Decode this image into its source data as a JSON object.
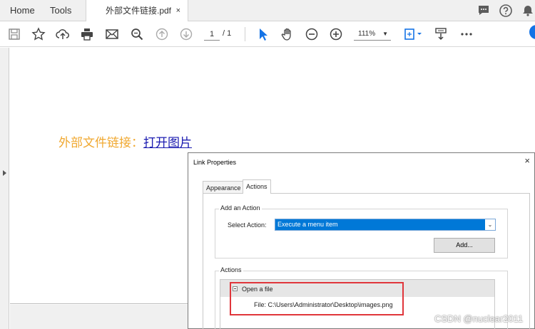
{
  "tabs": {
    "home": "Home",
    "tools": "Tools",
    "document": "外部文件链接.pdf",
    "close": "×"
  },
  "toolbar": {
    "icons": [
      "save-icon",
      "star-icon",
      "cloud-upload-icon",
      "print-icon",
      "email-icon",
      "zoom-search-icon",
      "page-up-icon",
      "page-down-icon",
      "select-arrow-icon",
      "hand-icon",
      "zoom-out-icon",
      "zoom-in-icon",
      "fit-page-icon",
      "scroll-mode-icon",
      "more-icon"
    ],
    "page_current": "1",
    "page_total": "/ 1",
    "zoom": "111%",
    "zoom_caret": "▼"
  },
  "document": {
    "text_prefix": "外部文件链接：",
    "link_text": "打开图片",
    "text_color": "#f0a830",
    "link_color": "#1a1ab0"
  },
  "dialog": {
    "title": "Link Properties",
    "close": "×",
    "tabs": [
      "Appearance",
      "Actions"
    ],
    "add_action": {
      "legend": "Add an Action",
      "select_label": "Select Action:",
      "select_value": "Execute a menu item",
      "add_button": "Add..."
    },
    "actions": {
      "legend": "Actions",
      "items": [
        {
          "label": "Open a file"
        },
        {
          "label": "File: C:\\Users\\Administrator\\Desktop\\images.png"
        }
      ]
    },
    "highlight_color": "#e0363b"
  },
  "watermark": "CSDN @nuclear2011"
}
